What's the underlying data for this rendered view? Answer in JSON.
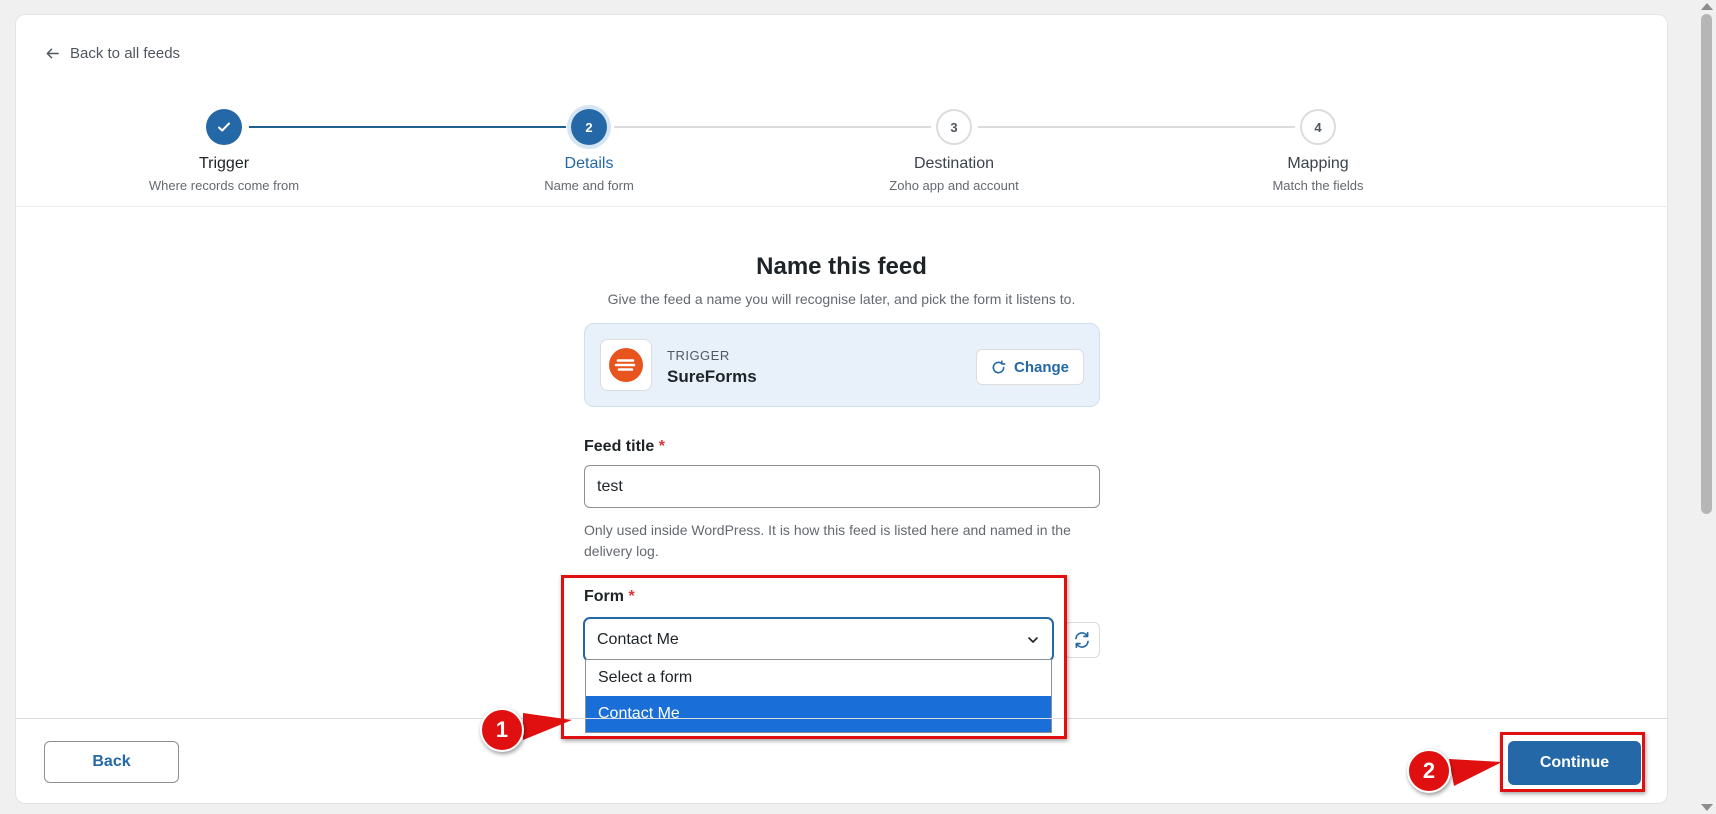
{
  "nav": {
    "back_label": "Back to all feeds"
  },
  "steps": [
    {
      "number": "",
      "title": "Trigger",
      "subtitle": "Where records come from",
      "state": "done"
    },
    {
      "number": "2",
      "title": "Details",
      "subtitle": "Name and form",
      "state": "active"
    },
    {
      "number": "3",
      "title": "Destination",
      "subtitle": "Zoho app and account",
      "state": "pending"
    },
    {
      "number": "4",
      "title": "Mapping",
      "subtitle": "Match the fields",
      "state": "pending"
    }
  ],
  "main": {
    "heading": "Name this feed",
    "subheading": "Give the feed a name you will recognise later, and pick the form it listens to."
  },
  "trigger": {
    "kicker": "TRIGGER",
    "name": "SureForms",
    "change_label": "Change",
    "logo_color": "#e8541e"
  },
  "feed_title": {
    "label": "Feed title",
    "required": "*",
    "value": "test",
    "help": "Only used inside WordPress. It is how this feed is listed here and named in the delivery log."
  },
  "form": {
    "label": "Form",
    "required": "*",
    "value": "Contact Me",
    "options": [
      "Select a form",
      "Contact Me"
    ],
    "selected_index": 1
  },
  "footer": {
    "back_label": "Back",
    "continue_label": "Continue"
  },
  "annotations": {
    "marker_1": "1",
    "marker_2": "2",
    "color": "#e01010"
  },
  "colors": {
    "primary": "#2468a8",
    "selected_option": "#1a6ed8",
    "required": "#d63638"
  }
}
